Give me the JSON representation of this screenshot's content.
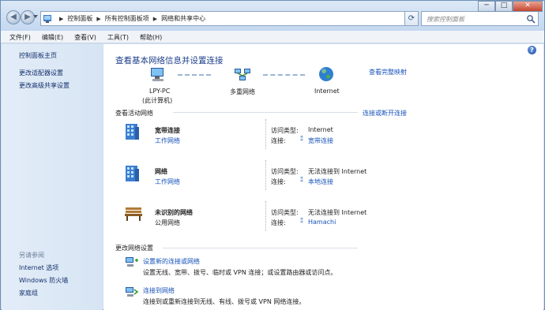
{
  "window": {
    "breadcrumbs": [
      "控制面板",
      "所有控制面板项",
      "网络和共享中心"
    ],
    "search_placeholder": "搜索控制面板",
    "caption": {
      "minimize": "─",
      "maximize": "□",
      "close": "✕"
    }
  },
  "menubar": [
    "文件(F)",
    "编辑(E)",
    "查看(V)",
    "工具(T)",
    "帮助(H)"
  ],
  "sidebar": {
    "links": [
      "控制面板主页",
      "更改适配器设置",
      "更改高级共享设置"
    ],
    "see_also_title": "另请参阅",
    "see_also": [
      "Internet 选项",
      "Windows 防火墙",
      "家庭组"
    ]
  },
  "main": {
    "title": "查看基本网络信息并设置连接",
    "map": {
      "pc_name": "LPY-PC",
      "pc_sub": "(此计算机)",
      "middle": "多重网络",
      "internet": "Internet",
      "full_map_link": "查看完整映射"
    },
    "active_title": "查看活动网络",
    "connect_link": "连接或断开连接",
    "networks": [
      {
        "name": "宽带连接",
        "type": "工作网络",
        "type_link": true,
        "access_label": "访问类型:",
        "access": "Internet",
        "conn_label": "连接:",
        "conn": "宽带连接",
        "icon": "building-network-icon"
      },
      {
        "name": "网络",
        "type": "工作网络",
        "type_link": true,
        "access_label": "访问类型:",
        "access": "无法连接到 Internet",
        "conn_label": "连接:",
        "conn": "本地连接",
        "icon": "building-network-icon"
      },
      {
        "name": "未识别的网络",
        "type": "公用网络",
        "type_link": false,
        "access_label": "访问类型:",
        "access": "无法连接到 Internet",
        "conn_label": "连接:",
        "conn": "Hamachi",
        "icon": "park-bench-icon"
      }
    ],
    "change_title": "更改网络设置",
    "tasks": [
      {
        "title": "设置新的连接或网络",
        "desc": "设置无线、宽带、拨号、临时或 VPN 连接；或设置路由器或访问点。"
      },
      {
        "title": "连接到网络",
        "desc": "连接到或重新连接到无线、有线、拨号或 VPN 网络连接。"
      }
    ]
  },
  "colors": {
    "link": "#1552b8",
    "title": "#1e3f8a",
    "sidebar": "#dfe9f5"
  }
}
